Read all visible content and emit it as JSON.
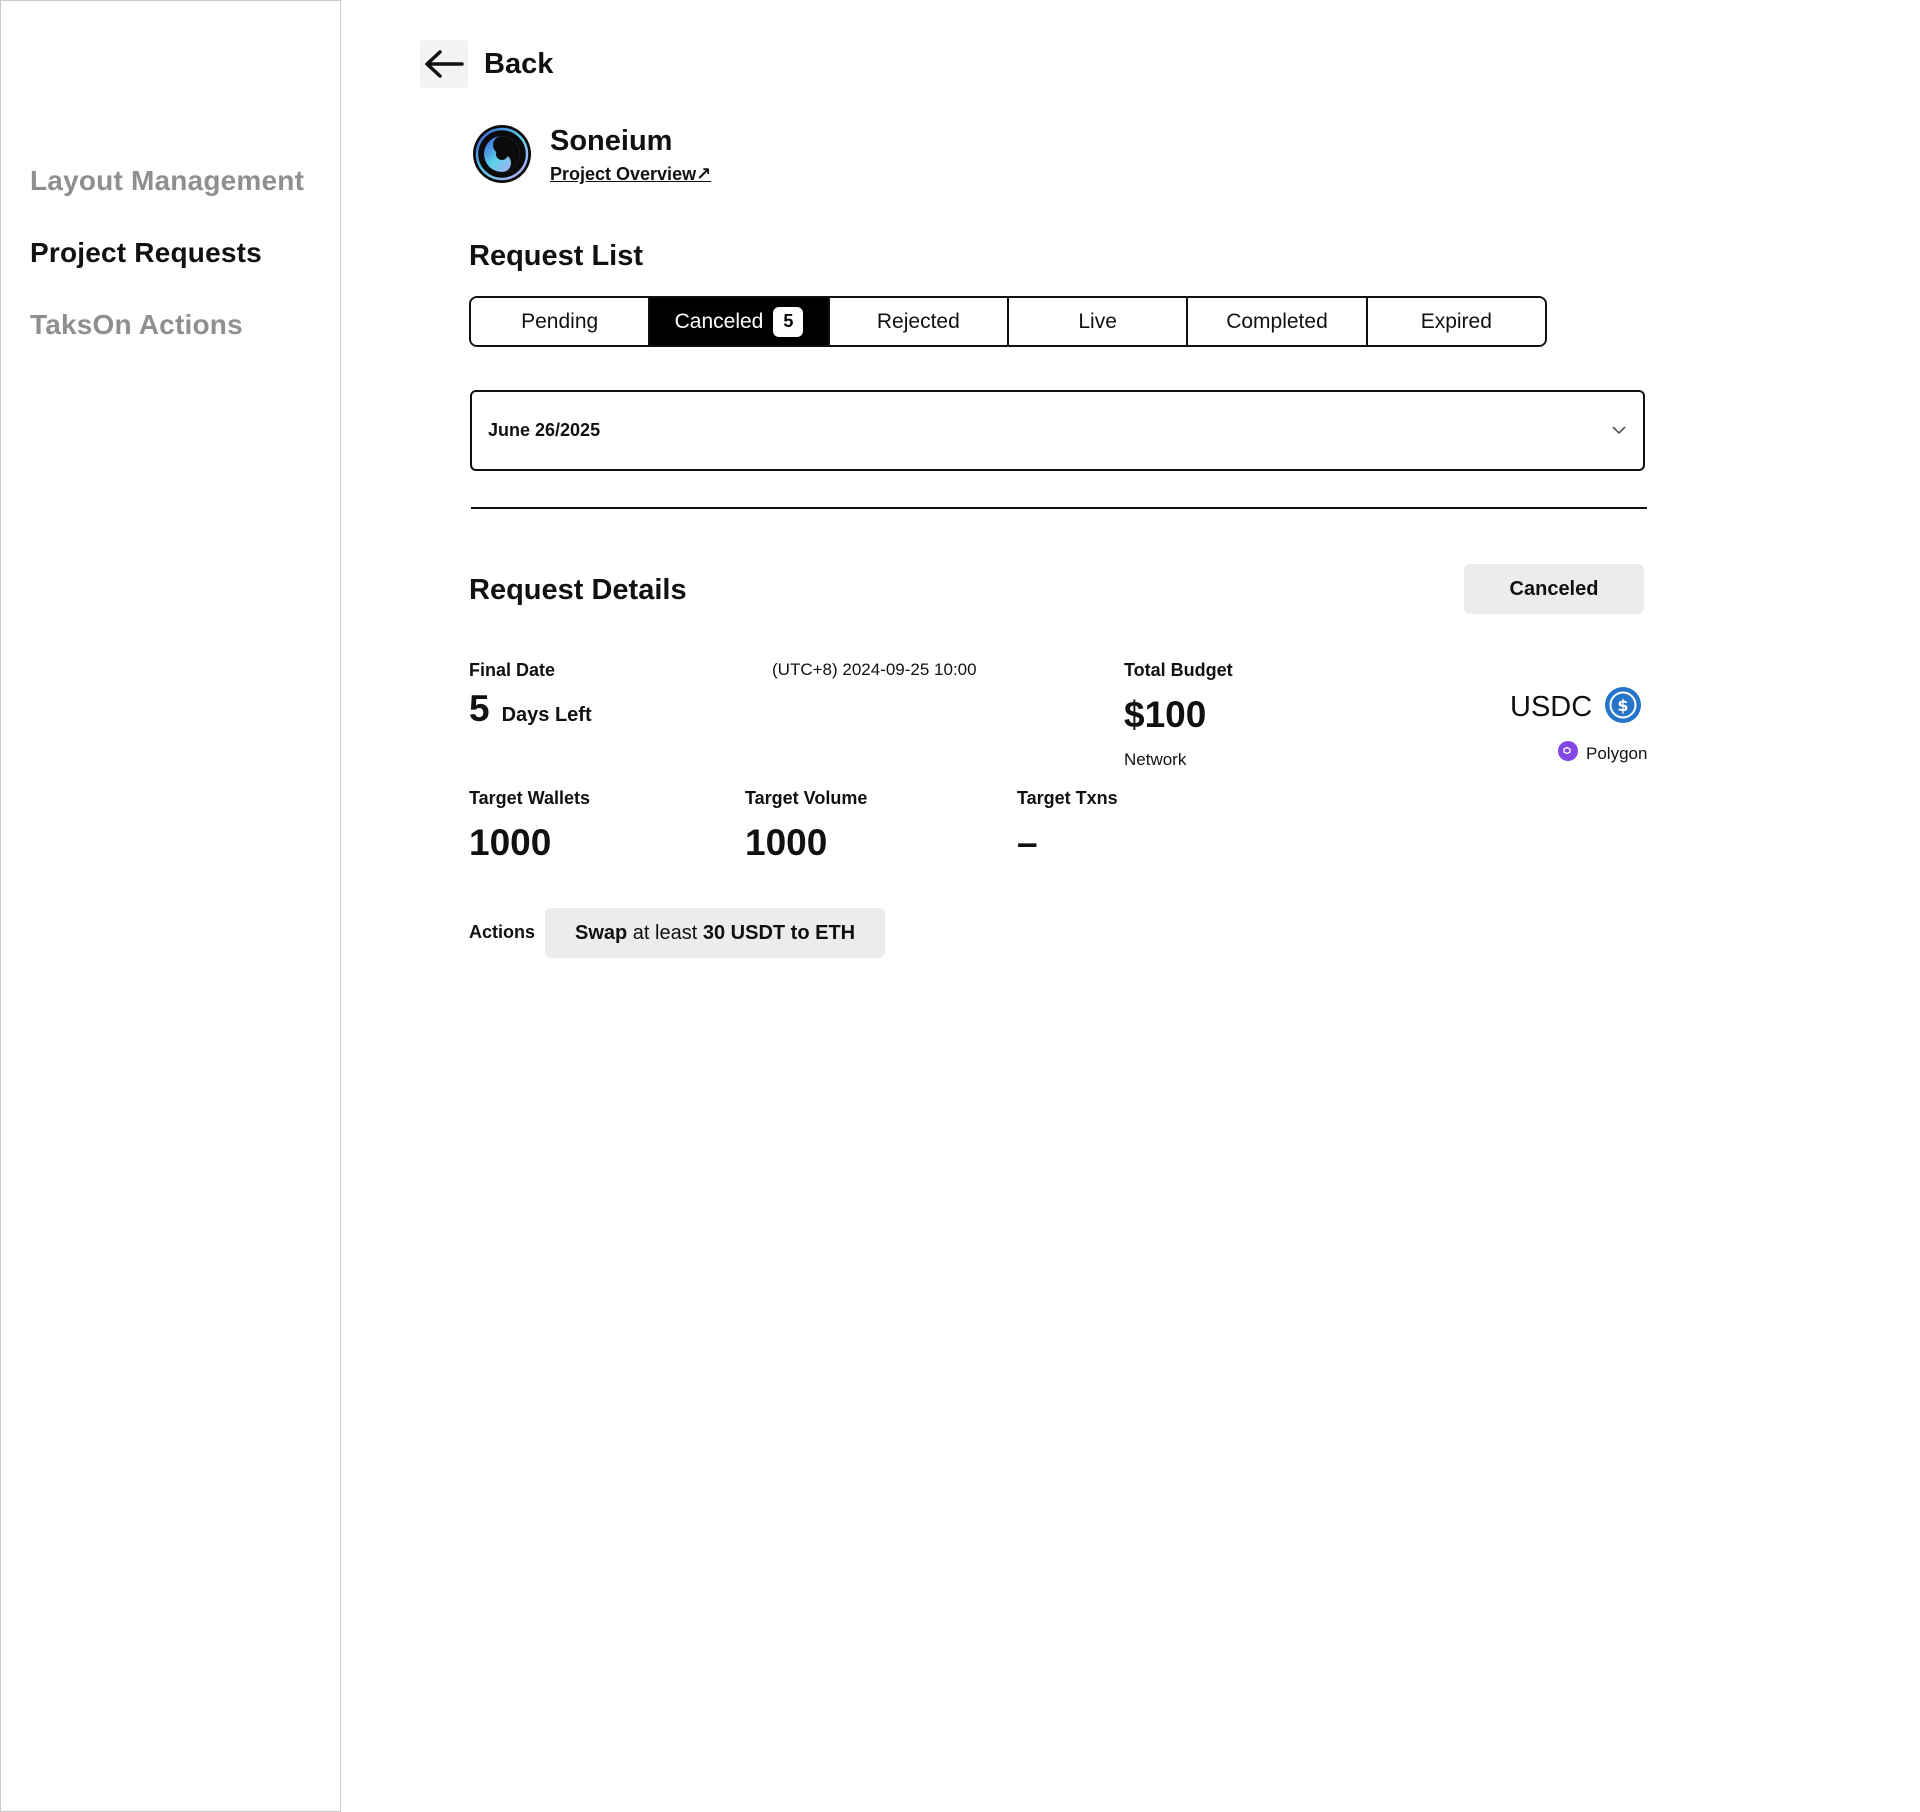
{
  "sidebar": {
    "items": [
      {
        "label": "Layout Management",
        "active": false
      },
      {
        "label": "Project Requests",
        "active": true
      },
      {
        "label": "TaksOn Actions",
        "active": false
      }
    ]
  },
  "header": {
    "back_label": "Back",
    "project_name": "Soneium",
    "project_link": "Project Overview↗"
  },
  "request_list": {
    "title": "Request List",
    "tabs": [
      {
        "label": "Pending"
      },
      {
        "label": "Canceled",
        "badge": "5",
        "active": true
      },
      {
        "label": "Rejected"
      },
      {
        "label": "Live"
      },
      {
        "label": "Completed"
      },
      {
        "label": "Expired"
      }
    ],
    "date_selected": "June 26/2025"
  },
  "details": {
    "title": "Request Details",
    "status": "Canceled",
    "final_date_label": "Final Date",
    "final_date_value": "(UTC+8) 2024-09-25 10:00",
    "days_left_number": "5",
    "days_left_text": "Days Left",
    "total_budget_label": "Total Budget",
    "total_budget_value": "$100",
    "currency": "USDC",
    "network_label": "Network",
    "network_value": "Polygon",
    "target_wallets_label": "Target Wallets",
    "target_wallets_value": "1000",
    "target_volume_label": "Target Volume",
    "target_volume_value": "1000",
    "target_txns_label": "Target Txns",
    "target_txns_value": "–",
    "actions_label": "Actions",
    "action": {
      "verb": "Swap",
      "mid": " at least ",
      "amount": "30 USDT",
      "to": " to ",
      "target": "ETH"
    }
  },
  "colors": {
    "accent": "#000000",
    "muted_text": "#8f8f8f",
    "chip_bg": "#ececec",
    "usdc_blue": "#2775ca",
    "polygon_purple": "#8247e5"
  },
  "icons": [
    "arrow-left-icon",
    "soneium-logo-icon",
    "chevron-down-icon",
    "usdc-icon",
    "polygon-icon"
  ]
}
